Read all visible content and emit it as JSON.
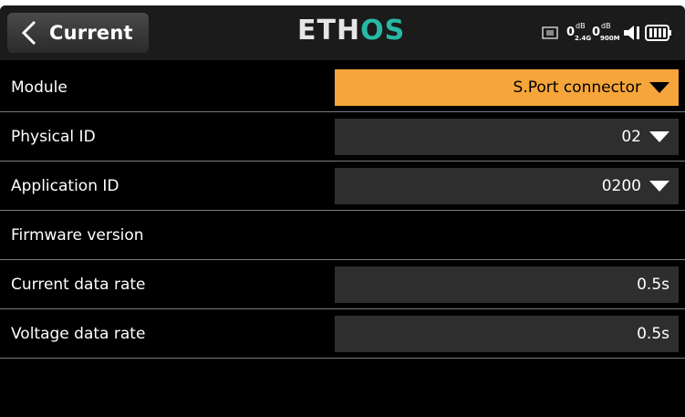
{
  "header": {
    "title": "Current",
    "logo_left": "ETH",
    "logo_right": "OS",
    "status": {
      "rssi_24": "0",
      "rssi_900": "0",
      "unit": "dB",
      "band_24": "2.4G",
      "band_900": "900M"
    }
  },
  "rows": [
    {
      "label": "Module",
      "value": "S.Port connector"
    },
    {
      "label": "Physical ID",
      "value": "02"
    },
    {
      "label": "Application ID",
      "value": "0200"
    },
    {
      "label": "Firmware version",
      "value": ""
    },
    {
      "label": "Current data rate",
      "value": "0.5s"
    },
    {
      "label": "Voltage data rate",
      "value": "0.5s"
    }
  ],
  "colors": {
    "accent": "#f5a53a",
    "field_bg": "#2e2e2e",
    "logo_os": "#27b9a6"
  }
}
